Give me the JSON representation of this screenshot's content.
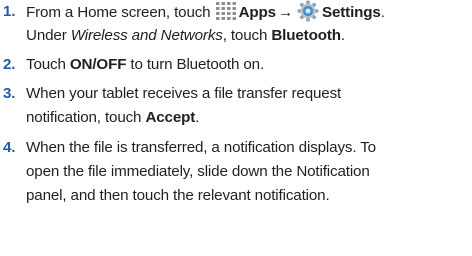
{
  "steps": [
    {
      "number": "1.",
      "line1_pre": "From a Home screen, touch",
      "apps_label": "Apps",
      "arrow": "→",
      "settings_label": "Settings",
      "line1_post": ".",
      "line2_pre": "Under",
      "wireless_label": "Wireless and Networks",
      "line2_mid": ", touch",
      "bluetooth_label": "Bluetooth",
      "line2_post": "."
    },
    {
      "number": "2.",
      "pre": "Touch",
      "onoff_label": "ON/OFF",
      "post": " to turn Bluetooth on."
    },
    {
      "number": "3.",
      "line1": "When your tablet receives a file transfer request",
      "line2_pre": "notification, touch",
      "accept_label": "Accept",
      "line2_post": "."
    },
    {
      "number": "4.",
      "line1": "When the file is transferred, a notification displays. To",
      "line2": "open the file immediately, slide down the Notification",
      "line3": "panel, and then touch the relevant notification."
    }
  ],
  "icons": {
    "apps": "apps-grid-icon",
    "settings": "settings-gear-icon"
  },
  "colors": {
    "step_number": "#1f5fa5",
    "text": "#231f20",
    "apps_icon": "#8d8d8d",
    "settings_icon": "#4a90c8"
  }
}
